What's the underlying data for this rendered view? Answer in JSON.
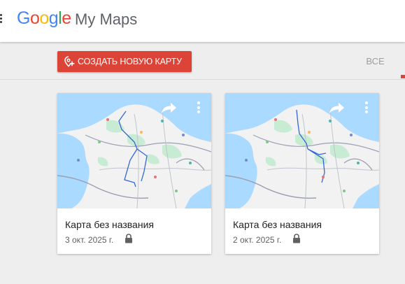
{
  "header": {
    "logo_letters": [
      {
        "char": "G",
        "color": "#4285F4"
      },
      {
        "char": "o",
        "color": "#EA4335"
      },
      {
        "char": "o",
        "color": "#FBBC05"
      },
      {
        "char": "g",
        "color": "#4285F4"
      },
      {
        "char": "l",
        "color": "#34A853"
      },
      {
        "char": "e",
        "color": "#EA4335"
      }
    ],
    "product_name": "My Maps",
    "menu_icon": "menu-dots-icon"
  },
  "toolbar": {
    "create_label": "СОЗДАТЬ НОВУЮ КАРТУ",
    "create_icon": "add-location-icon",
    "tab_all_label": "ВСЕ"
  },
  "colors": {
    "accent": "#db4437",
    "background": "#eeeeee",
    "map_water": "#aadaff",
    "map_land": "#f2f2f2",
    "map_park": "#c8ebd3",
    "route": "#3367d6"
  },
  "maps": [
    {
      "title": "Карта без названия",
      "date": "3 окт. 2025 г.",
      "visibility_icon": "lock-icon",
      "share_icon": "share-icon",
      "more_icon": "more-vert-icon"
    },
    {
      "title": "Карта без названия",
      "date": "2 окт. 2025 г.",
      "visibility_icon": "lock-icon",
      "share_icon": "share-icon",
      "more_icon": "more-vert-icon"
    }
  ]
}
